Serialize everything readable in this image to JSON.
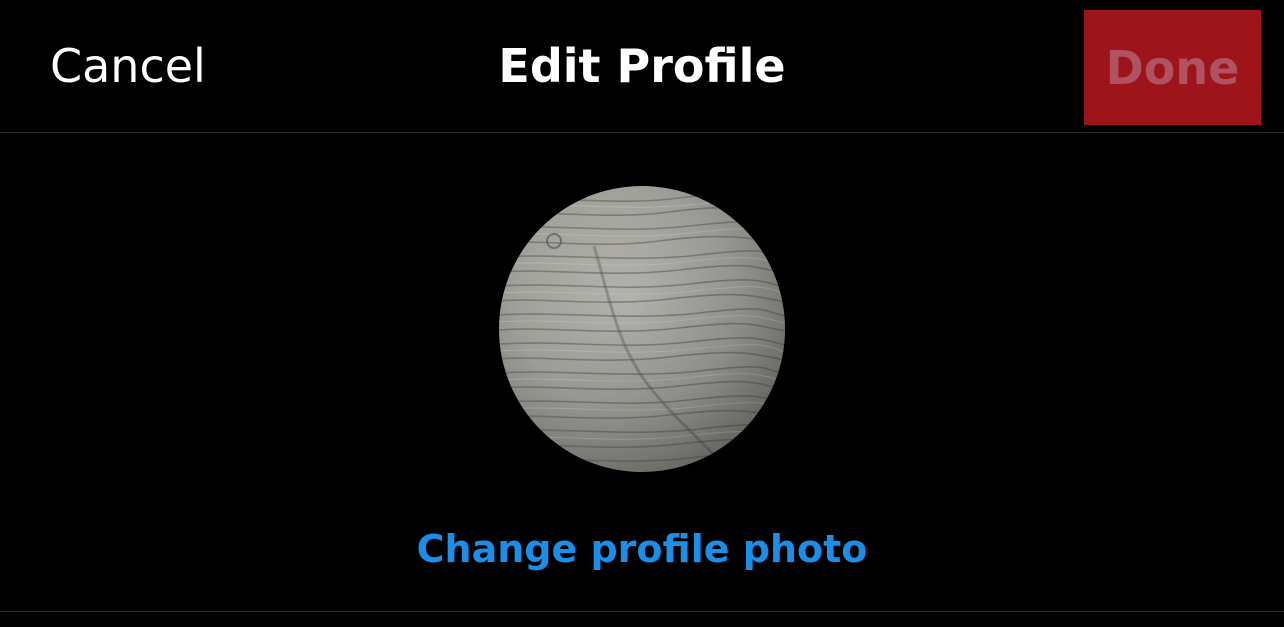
{
  "nav": {
    "cancel_label": "Cancel",
    "title": "Edit Profile",
    "done_label": "Done"
  },
  "profile": {
    "photo_description_icon": "wood-grain-avatar",
    "change_photo_label": "Change profile photo"
  },
  "colors": {
    "background": "#000000",
    "done_button_bg": "#9e141b",
    "done_button_text": "#b05262",
    "link_blue": "#1a8ee9",
    "divider": "#2c2c2e"
  }
}
